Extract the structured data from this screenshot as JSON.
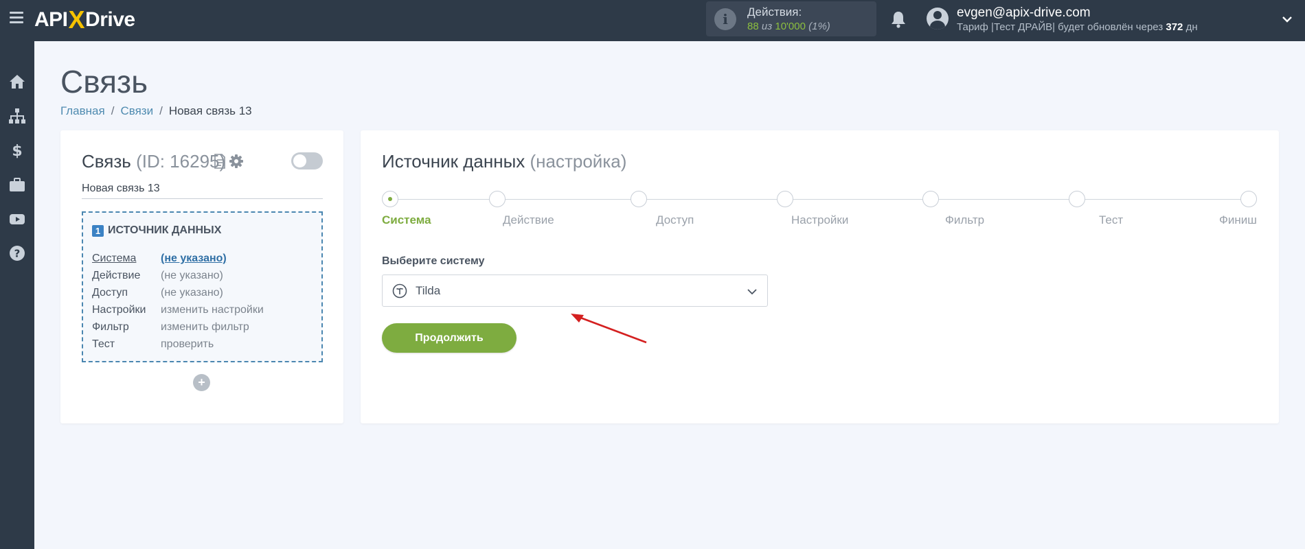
{
  "header": {
    "logo": {
      "prefix": "API",
      "x": "X",
      "suffix": "Drive"
    },
    "actions": {
      "label": "Действия:",
      "used": "88",
      "of_word": "из",
      "limit": "10'000",
      "percent": "(1%)"
    },
    "user": {
      "email": "evgen@apix-drive.com",
      "plan_prefix": "Тариф |Тест ДРАЙВ| будет обновлён через",
      "days": "372",
      "days_unit": "дн"
    }
  },
  "sidebar": {
    "items": [
      {
        "icon": "home-icon"
      },
      {
        "icon": "sitemap-icon"
      },
      {
        "icon": "dollar-icon"
      },
      {
        "icon": "briefcase-icon"
      },
      {
        "icon": "youtube-icon"
      },
      {
        "icon": "help-icon"
      }
    ]
  },
  "page": {
    "title": "Связь",
    "breadcrumb": [
      "Главная",
      "Связи",
      "Новая связь 13"
    ]
  },
  "connection": {
    "title": "Связь",
    "id_text": "(ID: 16295)",
    "name": "Новая связь 13",
    "source_box": {
      "number": "1",
      "heading": "ИСТОЧНИК ДАННЫХ",
      "rows": [
        {
          "key": "Система",
          "value": "(не указано)"
        },
        {
          "key": "Действие",
          "value": "(не указано)"
        },
        {
          "key": "Доступ",
          "value": "(не указано)"
        },
        {
          "key": "Настройки",
          "value": "изменить настройки"
        },
        {
          "key": "Фильтр",
          "value": "изменить фильтр"
        },
        {
          "key": "Тест",
          "value": "проверить"
        }
      ]
    },
    "add_symbol": "+"
  },
  "source": {
    "title": "Источник данных",
    "subtitle": "(настройка)",
    "steps": [
      "Система",
      "Действие",
      "Доступ",
      "Настройки",
      "Фильтр",
      "Тест",
      "Финиш"
    ],
    "select_label": "Выберите систему",
    "selected_system": "Tilda",
    "continue_label": "Продолжить"
  },
  "colors": {
    "topbar": "#2e3a48",
    "accent_green": "#7eac40",
    "link_blue": "#4f8bb0",
    "arrow_red": "#d42020"
  }
}
